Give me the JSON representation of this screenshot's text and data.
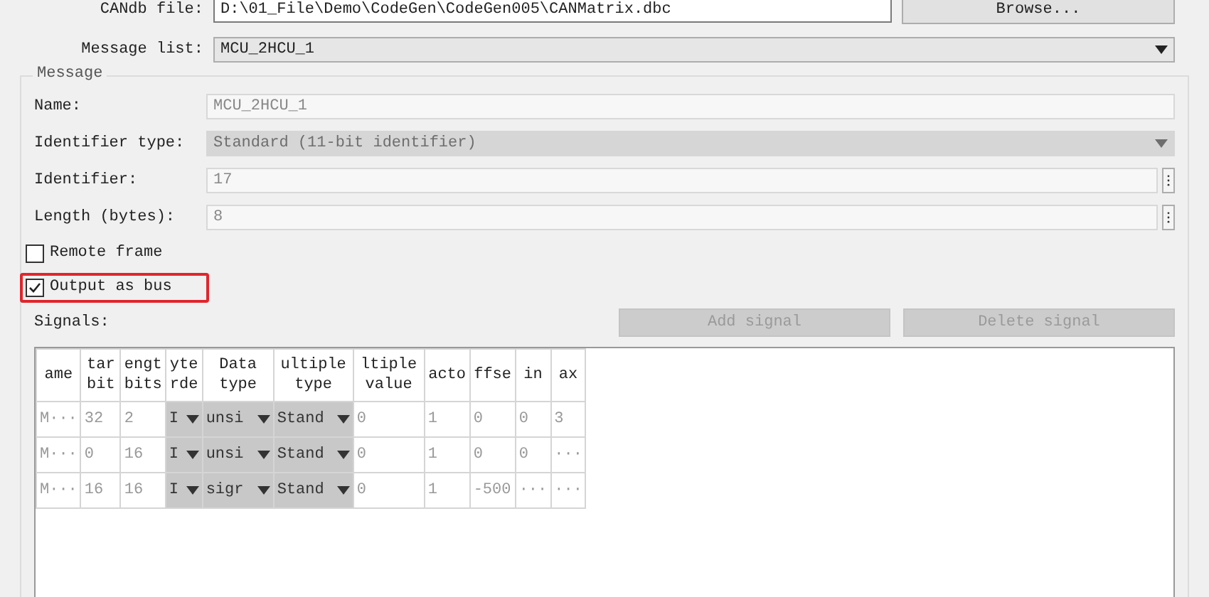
{
  "file_row": {
    "label": "CANdb file:",
    "value": "D:\\01_File\\Demo\\CodeGen\\CodeGen005\\CANMatrix.dbc",
    "button": "Browse..."
  },
  "message_list": {
    "label": "Message list:",
    "value": "MCU_2HCU_1"
  },
  "message": {
    "title": "Message",
    "fields": [
      {
        "kind": "text",
        "label": "Name:",
        "value": "MCU_2HCU_1",
        "disabled": true
      },
      {
        "kind": "combo",
        "label": "Identifier type:",
        "value": "Standard (11-bit identifier)",
        "disabled": true
      },
      {
        "kind": "spin",
        "label": "Identifier:",
        "value": "17",
        "disabled": true
      },
      {
        "kind": "spin",
        "label": "Length (bytes):",
        "value": "8",
        "disabled": true
      }
    ],
    "checkboxes": [
      {
        "label": "Remote frame",
        "checked": false,
        "highlighted": false
      },
      {
        "label": "Output as bus",
        "checked": true,
        "highlighted": true
      }
    ],
    "signals_label": "Signals:",
    "buttons": [
      {
        "label": "Add signal",
        "disabled": true
      },
      {
        "label": "Delete signal",
        "disabled": true
      }
    ],
    "table": {
      "columns": [
        "ame",
        "tar\nbit",
        "engt\nbits",
        "yte\nrde",
        "Data\ntype",
        "ultiple\ntype",
        "ltiple\nvalue",
        "acto",
        "ffse",
        "in",
        "ax"
      ],
      "rows": [
        [
          {
            "kind": "text",
            "text": "M···"
          },
          {
            "kind": "text",
            "text": "32"
          },
          {
            "kind": "text",
            "text": "2"
          },
          {
            "kind": "combo",
            "text": "I"
          },
          {
            "kind": "combo",
            "text": "unsi"
          },
          {
            "kind": "combo",
            "text": "Stand"
          },
          {
            "kind": "text",
            "text": "0"
          },
          {
            "kind": "text",
            "text": "1"
          },
          {
            "kind": "text",
            "text": "0"
          },
          {
            "kind": "text",
            "text": "0"
          },
          {
            "kind": "text",
            "text": "3"
          }
        ],
        [
          {
            "kind": "text",
            "text": "M···"
          },
          {
            "kind": "text",
            "text": "0"
          },
          {
            "kind": "text",
            "text": "16"
          },
          {
            "kind": "combo",
            "text": "I"
          },
          {
            "kind": "combo",
            "text": "unsi"
          },
          {
            "kind": "combo",
            "text": "Stand"
          },
          {
            "kind": "text",
            "text": "0"
          },
          {
            "kind": "text",
            "text": "1"
          },
          {
            "kind": "text",
            "text": "0"
          },
          {
            "kind": "text",
            "text": "0"
          },
          {
            "kind": "text",
            "text": "···"
          }
        ],
        [
          {
            "kind": "text",
            "text": "M···"
          },
          {
            "kind": "text",
            "text": "16"
          },
          {
            "kind": "text",
            "text": "16"
          },
          {
            "kind": "combo",
            "text": "I"
          },
          {
            "kind": "combo",
            "text": "sigr"
          },
          {
            "kind": "combo",
            "text": "Stand"
          },
          {
            "kind": "text",
            "text": "0"
          },
          {
            "kind": "text",
            "text": "1"
          },
          {
            "kind": "text",
            "text": "-500"
          },
          {
            "kind": "text",
            "text": "···"
          },
          {
            "kind": "text",
            "text": "···"
          }
        ]
      ]
    }
  }
}
